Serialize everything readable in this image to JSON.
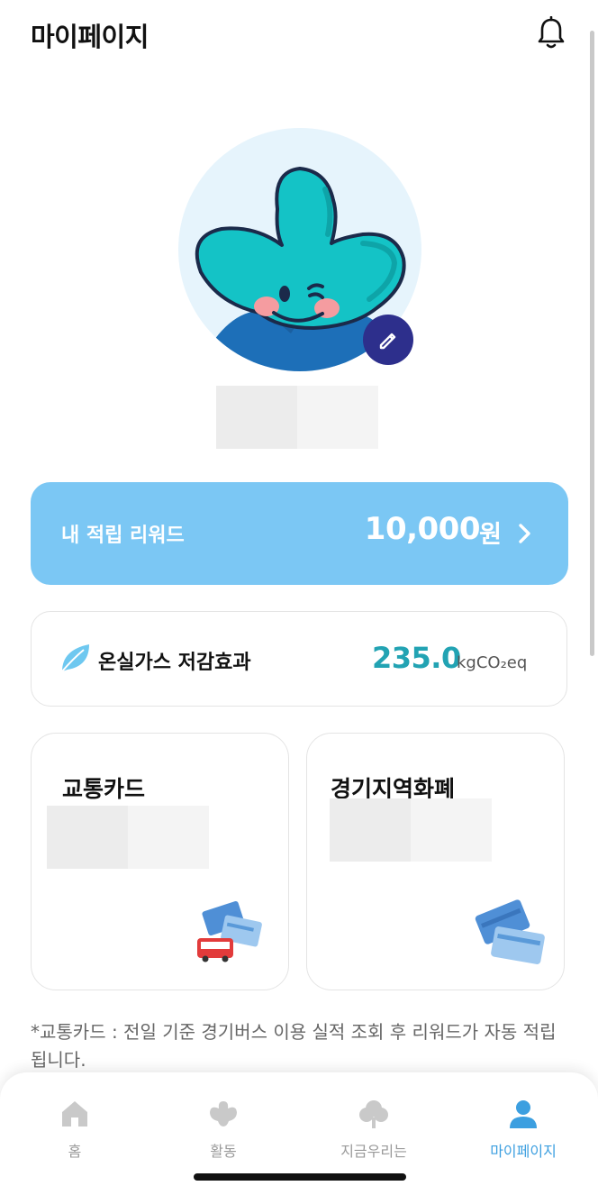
{
  "header": {
    "title": "마이페이지",
    "bell_icon": "bell-icon"
  },
  "profile": {
    "avatar_icon": "mascot-avatar",
    "edit_icon": "pencil-icon",
    "name": ""
  },
  "reward": {
    "label": "내 적립 리워드",
    "amount": "10,000",
    "unit": "원",
    "chevron_icon": "chevron-right-icon"
  },
  "ghg": {
    "icon": "leaf-icon",
    "label": "온실가스 저감효과",
    "value": "235.0",
    "unit": "kgCO₂eq"
  },
  "cards": [
    {
      "title": "교통카드",
      "value": "",
      "illustration": "transport-card-bus-illustration"
    },
    {
      "title": "경기지역화폐",
      "value": "",
      "illustration": "local-currency-cards-illustration"
    }
  ],
  "note": "*교통카드 : 전일 기준 경기버스 이용 실적 조회 후 리워드가 자동 적립됩니다.",
  "tabs": [
    {
      "label": "홈",
      "icon": "home-icon",
      "active": false
    },
    {
      "label": "활동",
      "icon": "activity-icon",
      "active": false
    },
    {
      "label": "지금우리는",
      "icon": "tree-icon",
      "active": false
    },
    {
      "label": "마이페이지",
      "icon": "person-icon",
      "active": true
    }
  ],
  "colors": {
    "accent": "#3c9fe0",
    "reward_bg": "#7bc7f4",
    "ghg_value": "#22a3b3",
    "edit_button": "#2d2f8c"
  }
}
